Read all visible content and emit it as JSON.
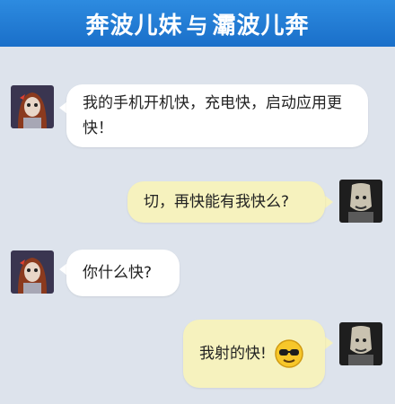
{
  "title": {
    "left": "奔波儿妹",
    "mid": "与",
    "right": "灞波儿奔"
  },
  "messages": [
    {
      "side": "left",
      "text": "我的手机开机快，充电快，启动应用更快！"
    },
    {
      "side": "right",
      "text": "切，再快能有我快么?"
    },
    {
      "side": "left",
      "text": "你什么快?"
    },
    {
      "side": "right",
      "text": "我射的快!",
      "emoji": "cool-sunglasses-emoji"
    }
  ],
  "colors": {
    "header": "#1a6fc9",
    "background": "#dde3ec",
    "left_bubble": "#ffffff",
    "right_bubble": "#f6f2be"
  }
}
